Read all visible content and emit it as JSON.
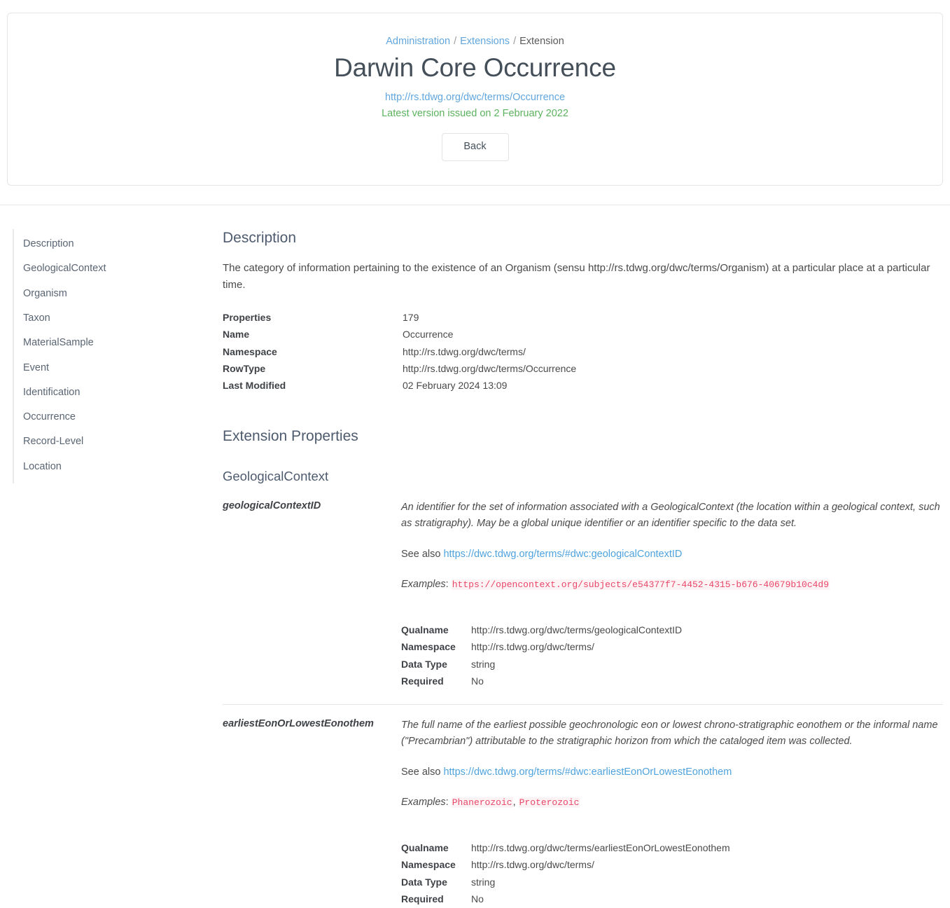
{
  "header": {
    "breadcrumb": [
      {
        "label": "Administration",
        "link": true
      },
      {
        "label": "Extensions",
        "link": true
      },
      {
        "label": "Extension",
        "link": false
      }
    ],
    "separator": "/",
    "title": "Darwin Core Occurrence",
    "url": "http://rs.tdwg.org/dwc/terms/Occurrence",
    "version_line": "Latest version issued on 2 February 2022",
    "back_label": "Back",
    "colors": {
      "link": "#61a6dd",
      "green": "#5cb25e",
      "heading": "#454f59"
    }
  },
  "sidebar": {
    "items": [
      {
        "label": "Description"
      },
      {
        "label": "GeologicalContext"
      },
      {
        "label": "Organism"
      },
      {
        "label": "Taxon"
      },
      {
        "label": "MaterialSample"
      },
      {
        "label": "Event"
      },
      {
        "label": "Identification"
      },
      {
        "label": "Occurrence"
      },
      {
        "label": "Record-Level"
      },
      {
        "label": "Location"
      }
    ]
  },
  "main": {
    "description": {
      "heading": "Description",
      "text": "The category of information pertaining to the existence of an Organism (sensu http://rs.tdwg.org/dwc/terms/Organism) at a particular place at a particular time.",
      "meta": [
        {
          "key": "Properties",
          "value": "179"
        },
        {
          "key": "Name",
          "value": "Occurrence"
        },
        {
          "key": "Namespace",
          "value": "http://rs.tdwg.org/dwc/terms/"
        },
        {
          "key": "RowType",
          "value": "http://rs.tdwg.org/dwc/terms/Occurrence"
        },
        {
          "key": "Last Modified",
          "value": "02 February 2024 13:09"
        }
      ]
    },
    "extension_properties": {
      "heading": "Extension Properties",
      "group_heading": "GeologicalContext",
      "see_also_label": "See also",
      "examples_label": "Examples",
      "properties": [
        {
          "name": "geologicalContextID",
          "description": "An identifier for the set of information associated with a GeologicalContext (the location within a geological context, such as stratigraphy). May be a global unique identifier or an identifier specific to the data set.",
          "see_also": "https://dwc.tdwg.org/terms/#dwc:geologicalContextID",
          "examples": [
            "https://opencontext.org/subjects/e54377f7-4452-4315-b676-40679b10c4d9"
          ],
          "meta": [
            {
              "key": "Qualname",
              "value": "http://rs.tdwg.org/dwc/terms/geologicalContextID"
            },
            {
              "key": "Namespace",
              "value": "http://rs.tdwg.org/dwc/terms/"
            },
            {
              "key": "Data Type",
              "value": "string"
            },
            {
              "key": "Required",
              "value": "No"
            }
          ]
        },
        {
          "name": "earliestEonOrLowestEonothem",
          "description": "The full name of the earliest possible geochronologic eon or lowest chrono-stratigraphic eonothem or the informal name (\"Precambrian\") attributable to the stratigraphic horizon from which the cataloged item was collected.",
          "see_also": "https://dwc.tdwg.org/terms/#dwc:earliestEonOrLowestEonothem",
          "examples": [
            "Phanerozoic",
            "Proterozoic"
          ],
          "meta": [
            {
              "key": "Qualname",
              "value": "http://rs.tdwg.org/dwc/terms/earliestEonOrLowestEonothem"
            },
            {
              "key": "Namespace",
              "value": "http://rs.tdwg.org/dwc/terms/"
            },
            {
              "key": "Data Type",
              "value": "string"
            },
            {
              "key": "Required",
              "value": "No"
            }
          ]
        }
      ]
    }
  }
}
